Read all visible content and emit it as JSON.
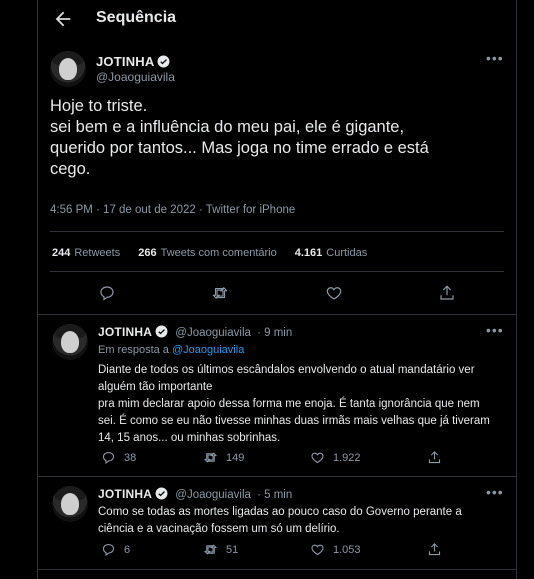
{
  "header": {
    "title": "Sequência"
  },
  "main_tweet": {
    "name": "JOTINHA",
    "handle": "@Joaoguiavila",
    "lines": [
      "Hoje to triste.",
      "sei bem e a influência do meu pai, ele é gigante,",
      "querido por tantos... Mas joga no time errado e está",
      "cego."
    ],
    "meta": "4:56 PM · 17 de out de 2022 · Twitter for iPhone",
    "stats": {
      "retweets_count": "244",
      "retweets_label": "Retweets",
      "quotes_count": "266",
      "quotes_label": "Tweets com comentário",
      "likes_count": "4.161",
      "likes_label": "Curtidas"
    }
  },
  "replies": [
    {
      "name": "JOTINHA",
      "handle": "@Joaoguiavila",
      "time": "· 9 min",
      "reply_prefix": "Em resposta a",
      "reply_target": "@Joaoguiavila",
      "lines": [
        "Diante de todos os últimos escândalos envolvendo o atual mandatário ver",
        "alguém tão importante",
        "pra mim declarar apoio dessa forma  me enoja. É tanta ignorância que nem",
        "sei. É como se eu não tivesse minhas duas irmãs mais velhas que já tiveram",
        "14, 15 anos... ou minhas sobrinhas."
      ],
      "replies_count": "38",
      "retweets_count": "149",
      "likes_count": "1.922"
    },
    {
      "name": "JOTINHA",
      "handle": "@Joaoguiavila",
      "time": "· 5 min",
      "lines": [
        "Como se todas as mortes ligadas ao pouco caso do Governo perante a",
        "ciência e a vacinação fossem um só um delírio."
      ],
      "replies_count": "6",
      "retweets_count": "51",
      "likes_count": "1.053"
    }
  ],
  "colors": {
    "background": "#000000",
    "text": "#e7e9ea",
    "muted": "#8b98a5",
    "link": "#1d9bf0",
    "border": "#2f3336"
  },
  "icons": [
    "back-arrow-icon",
    "verified-badge-icon",
    "more-icon",
    "reply-icon",
    "retweet-icon",
    "like-icon",
    "share-icon"
  ]
}
